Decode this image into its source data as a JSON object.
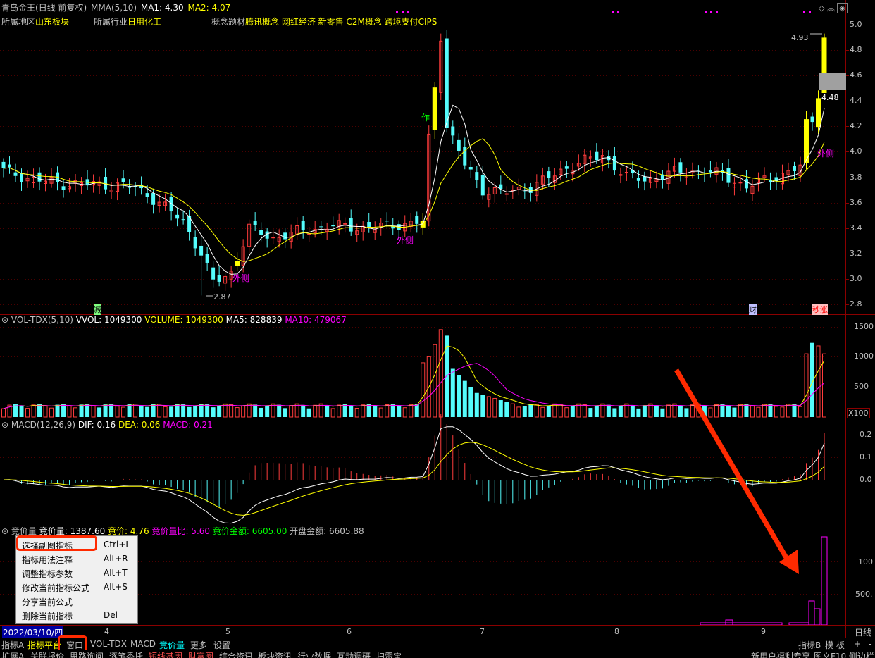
{
  "header": {
    "stock_name": "青岛金王",
    "period": "(日线 前复权)",
    "indicator": "MMA(5,10)",
    "ma1": "MA1: 4.30",
    "ma2": "MA2: 4.07",
    "region_label": "所属地区",
    "region_value": "山东板块",
    "industry_label": "所属行业",
    "industry_value": "日用化工",
    "concept_label": "概念题材",
    "concept_value": "腾讯概念 网红经济 新零售 C2M概念 跨境支付CIPS"
  },
  "price_axis": [
    "5.0",
    "4.8",
    "4.6",
    "4.4",
    "4.2",
    "4.0",
    "3.8",
    "3.6",
    "3.4",
    "3.2",
    "3.0",
    "2.8"
  ],
  "price_annotations": {
    "high": "4.93",
    "low": "2.87",
    "current": "4.48",
    "tag1": "外侧",
    "tag2": "外侧",
    "tag3": "外侧",
    "tag_zuo": "作",
    "tag_jian": "减",
    "tag_cai": "财",
    "tag_yizhang": "秒涨"
  },
  "volume_panel": {
    "title": "VOL-TDX(5,10)",
    "vvol": "VVOL: 1049300",
    "volume": "VOLUME: 1049300",
    "ma5": "MA5: 828839",
    "ma10": "MA10: 479067",
    "axis": [
      "1500",
      "1000",
      "500"
    ],
    "unit": "X100"
  },
  "macd_panel": {
    "title": "MACD(12,26,9)",
    "dif": "DIF: 0.16",
    "dea": "DEA: 0.06",
    "macd": "MACD: 0.21",
    "axis": [
      "0.2",
      "0.1",
      "0.0"
    ]
  },
  "auction_panel": {
    "title": "竟价量",
    "vol": "竟价量: 1387.60",
    "price": "竟价: 4.76",
    "ratio": "竟价量比: 5.60",
    "amount": "竟价金额: 6605.00",
    "open_amount": "开盘金额: 6605.88",
    "axis": [
      "100",
      "500."
    ]
  },
  "context_menu": {
    "items": [
      {
        "label": "选择副图指标",
        "shortcut": "Ctrl+I"
      },
      {
        "label": "指标用法注释",
        "shortcut": "Alt+R"
      },
      {
        "label": "调整指标参数",
        "shortcut": "Alt+T"
      },
      {
        "label": "修改当前指标公式",
        "shortcut": "Alt+S"
      },
      {
        "label": "分享当前公式",
        "shortcut": ""
      },
      {
        "label": "删除当前指标",
        "shortcut": "Del"
      }
    ]
  },
  "date_axis": {
    "selected": "2022/03/10/四",
    "months": [
      "4",
      "5",
      "6",
      "7",
      "8",
      "9"
    ],
    "right_label": "日线"
  },
  "tabs": {
    "left": [
      "指标A",
      "指标平台",
      "窗口",
      "VOL-TDX",
      "MACD",
      "竟价量",
      "更多",
      "设置"
    ],
    "right": [
      "指标B",
      "模 板",
      "+",
      "-"
    ]
  },
  "bottom_bar": {
    "items": [
      "扩展A",
      "关联报价",
      "思路询问",
      "逐笔委托",
      "短线基因",
      "财富圈",
      "综合资讯",
      "板块资讯",
      "行业数据",
      "互动调研",
      "扫雷宝"
    ],
    "right": [
      "新用户福利专享",
      "图文F10",
      "侧边栏"
    ]
  },
  "colors": {
    "up": "#ff3c3c",
    "down": "#54fcfc",
    "ma_yellow": "#ffff00",
    "ma_white": "#ffffff",
    "ma_magenta": "#ff00ff",
    "grid": "#8b0000",
    "highlight_box": "#ff2a00",
    "arrow": "#ff2a00"
  }
}
